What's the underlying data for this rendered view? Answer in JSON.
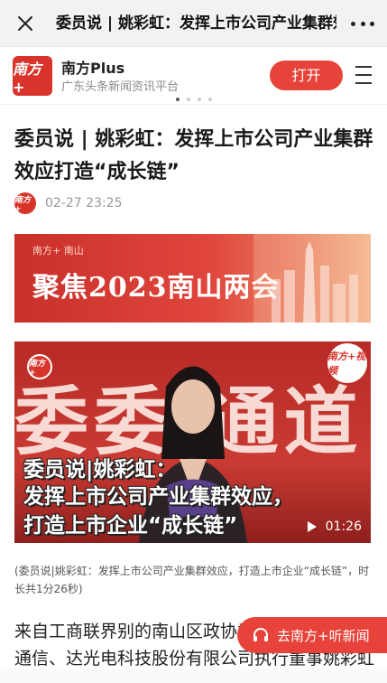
{
  "topbar": {
    "title": "委员说 | 姚彩虹：发挥上市公司产业集群效应打造“成长链”",
    "close_icon": "close-icon",
    "more_icon": "more-dots-icon"
  },
  "promo": {
    "logo_text": "南方+",
    "app_name": "南方Plus",
    "slogan": "广东头条新闻资讯平台",
    "open_label": "打开",
    "menu_icon": "hamburger-menu-icon",
    "carousel_pages": 4,
    "carousel_active": 1
  },
  "article": {
    "headline": "委员说 | 姚彩虹：发挥上市公司产业集群效应打造“成长链”",
    "avatar_text": "南方+",
    "time": "02-27 23:25"
  },
  "banner": {
    "small_label": "南方+  南山",
    "text": "聚焦2023南山两会"
  },
  "video": {
    "logo_text": "南方+",
    "badge_text": "南方+视频",
    "bg_text": "委委 通道",
    "caption_line1": "委员说|姚彩虹：",
    "caption_line2": "发挥上市公司产业集群效应，",
    "caption_line3": "打造上市企业“成长链”",
    "duration": "01:26",
    "play_icon": "play-icon"
  },
  "caption": "(委员说|姚彩虹：发挥上市公司产业集群效应，打造上市企业“成长链”，时长共1分26秒)",
  "body": "来自工商联界别的南山区政协委员、深圳市信维通信、达光电科技股份有限公司执行董事姚彩虹表",
  "listen": {
    "label": "去南方+听新闻",
    "icon": "headphones-icon"
  },
  "colors": {
    "brand_red": "#e8433a",
    "topbar_bg": "#f2f2f2"
  }
}
